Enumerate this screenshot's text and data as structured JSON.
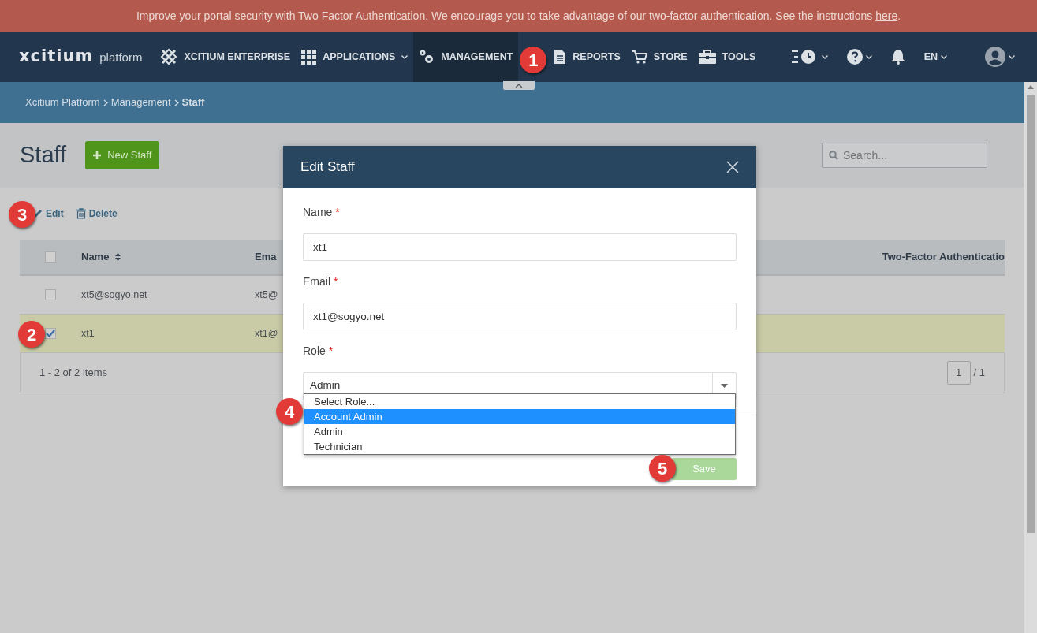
{
  "banner": {
    "text": "Improve your portal security with Two Factor Authentication. We encourage you to take advantage of our two-factor authentication. See the instructions ",
    "link": "here",
    "suffix": "."
  },
  "navbar": {
    "logo": {
      "wordmark": "xcitium",
      "subtitle": "platform"
    },
    "items": [
      {
        "label": "XCITIUM ENTERPRISE",
        "kind": "enterprise",
        "dropdown": false,
        "selected": false
      },
      {
        "label": "APPLICATIONS",
        "kind": "grid",
        "dropdown": true,
        "selected": false
      },
      {
        "label": "MANAGEMENT",
        "kind": "gears",
        "dropdown": false,
        "selected": true
      },
      {
        "label": "REPORTS",
        "kind": "document",
        "dropdown": false,
        "selected": false
      },
      {
        "label": "STORE",
        "kind": "cart",
        "dropdown": false,
        "selected": false
      },
      {
        "label": "TOOLS",
        "kind": "toolbox",
        "dropdown": false,
        "selected": false
      }
    ],
    "right": [
      {
        "kind": "history",
        "dropdown": true
      },
      {
        "kind": "help",
        "dropdown": true
      },
      {
        "kind": "bell",
        "dropdown": false
      },
      {
        "kind": "language",
        "label": "EN",
        "dropdown": true
      },
      {
        "kind": "user",
        "dropdown": true
      }
    ]
  },
  "breadcrumb": [
    {
      "label": "Xcitium Platform",
      "current": false
    },
    {
      "label": "Management",
      "current": false
    },
    {
      "label": "Staff",
      "current": true
    }
  ],
  "page": {
    "title": "Staff",
    "new_button": "New Staff",
    "search": {
      "placeholder": "Search..."
    }
  },
  "toolbar": [
    {
      "label": "Edit",
      "kind": "pencil"
    },
    {
      "label": "Delete",
      "kind": "trash"
    }
  ],
  "table": {
    "select_all_checked": false,
    "columns": [
      {
        "label": "Name",
        "sortable": true
      },
      {
        "label": "Ema",
        "sortable": false
      },
      {
        "label": "Two-Factor Authenticatio",
        "sortable": false
      }
    ],
    "rows": [
      {
        "checked": false,
        "selected": false,
        "cells": [
          "xt5@sogyo.net",
          "xt5@",
          ""
        ]
      },
      {
        "checked": true,
        "selected": true,
        "cells": [
          "xt1",
          "xt1@",
          ""
        ]
      }
    ],
    "footer": {
      "summary": "1 - 2 of 2 items",
      "page": "1",
      "total": "/ 1"
    }
  },
  "modal": {
    "title": "Edit Staff",
    "fields": [
      {
        "kind": "text",
        "label": "Name",
        "required_mark": "*",
        "value": "xt1"
      },
      {
        "kind": "text",
        "label": "Email",
        "required_mark": "*",
        "value": "xt1@sogyo.net"
      },
      {
        "kind": "select",
        "label": "Role",
        "required_mark": "*",
        "value": "Admin"
      }
    ],
    "options": [
      {
        "label": "Select Role...",
        "selected": false
      },
      {
        "label": "Account Admin",
        "selected": true
      },
      {
        "label": "Admin",
        "selected": false
      },
      {
        "label": "Technician",
        "selected": false
      }
    ],
    "save": {
      "label": "Save",
      "disabled": true
    }
  },
  "markers": [
    "1",
    "2",
    "3",
    "4",
    "5"
  ]
}
